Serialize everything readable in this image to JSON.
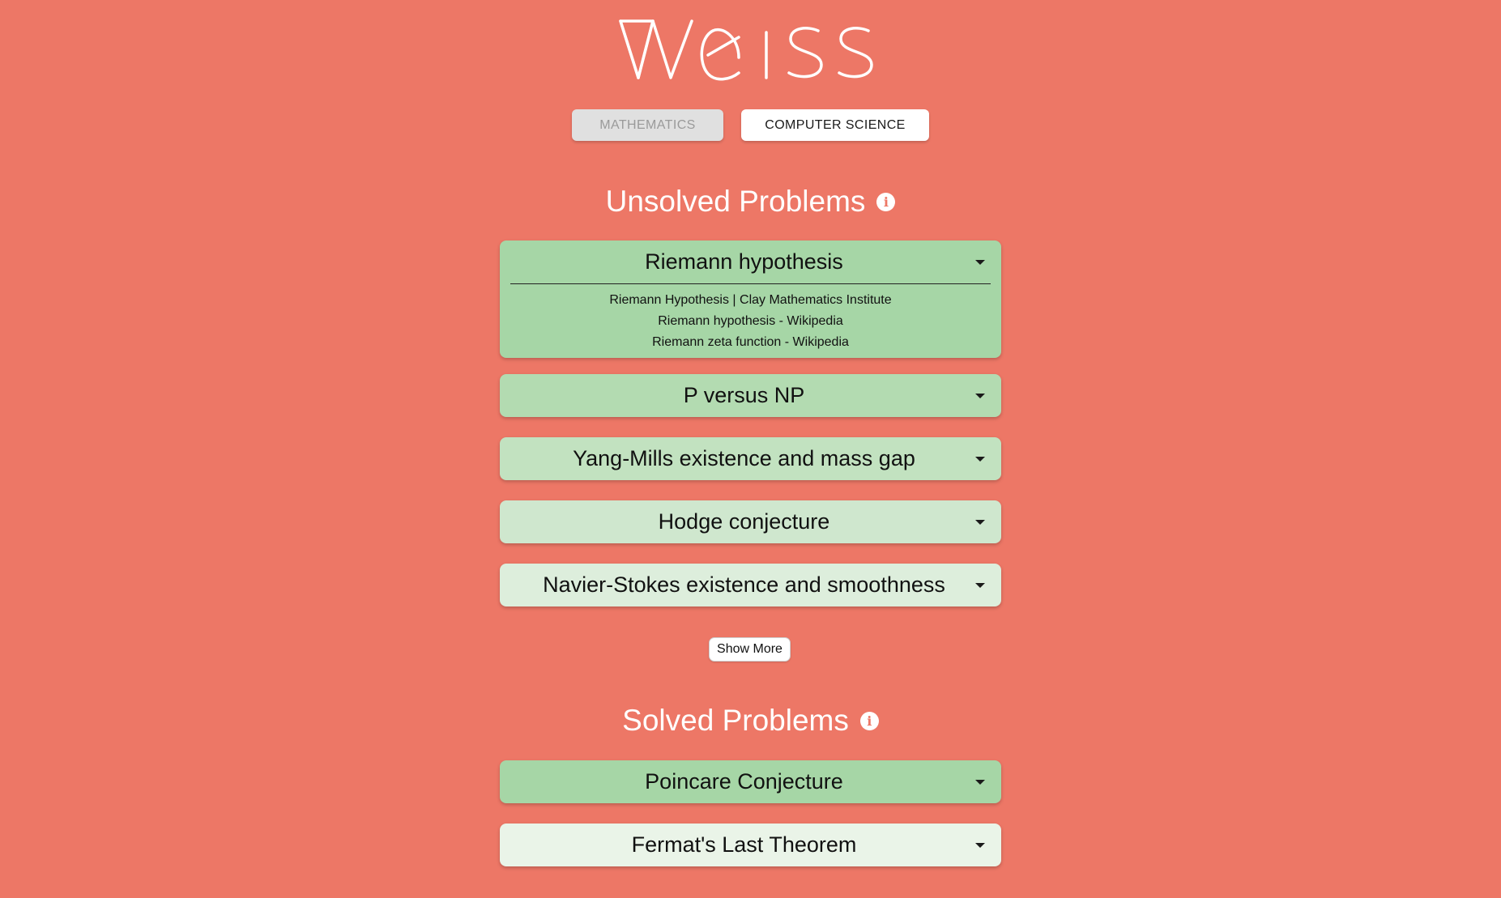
{
  "brand": {
    "logo_text": "weiss"
  },
  "tabs": [
    {
      "label": "MATHEMATICS",
      "active": false
    },
    {
      "label": "COMPUTER SCIENCE",
      "active": true
    }
  ],
  "unsolved": {
    "heading": "Unsolved Problems",
    "info_icon": "info-icon",
    "problems": [
      {
        "title": "Riemann hypothesis",
        "expanded": true,
        "color": "#A6D6A6",
        "links": [
          "Riemann Hypothesis | Clay Mathematics Institute",
          "Riemann hypothesis - Wikipedia",
          "Riemann zeta function - Wikipedia"
        ]
      },
      {
        "title": "P versus NP",
        "expanded": false,
        "color": "#B3DBB1"
      },
      {
        "title": "Yang-Mills existence and mass gap",
        "expanded": false,
        "color": "#C2E2C0"
      },
      {
        "title": "Hodge conjecture",
        "expanded": false,
        "color": "#CFE7CE"
      },
      {
        "title": "Navier-Stokes existence and smoothness",
        "expanded": false,
        "color": "#DDEEDC"
      }
    ],
    "show_more_label": "Show More"
  },
  "solved": {
    "heading": "Solved Problems",
    "info_icon": "info-icon",
    "problems": [
      {
        "title": "Poincare Conjecture",
        "expanded": false,
        "color": "#A6D6A6"
      },
      {
        "title": "Fermat's Last Theorem",
        "expanded": false,
        "color": "#EAF4E8"
      }
    ]
  },
  "colors": {
    "background": "#ED7766",
    "tab_inactive_bg": "#E0E0E0",
    "tab_active_bg": "#FFFFFF"
  }
}
